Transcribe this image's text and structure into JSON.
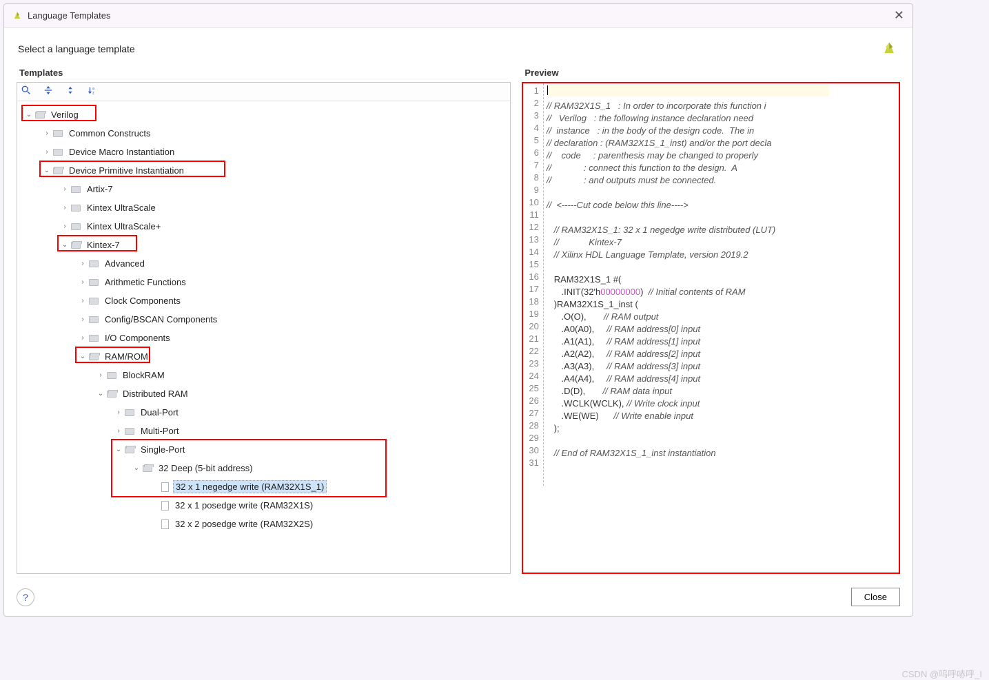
{
  "window": {
    "title": "Language Templates",
    "subtitle": "Select a language template",
    "close_label": "Close"
  },
  "panels": {
    "templates_header": "Templates",
    "preview_header": "Preview"
  },
  "toolbar_icons": [
    "search-icon",
    "collapse-icon",
    "expand-icon",
    "settings-icon"
  ],
  "tree": [
    {
      "depth": 0,
      "exp": "open",
      "icon": "folder",
      "label": "Verilog",
      "hl": true
    },
    {
      "depth": 1,
      "exp": "closed",
      "icon": "folder",
      "label": "Common Constructs"
    },
    {
      "depth": 1,
      "exp": "closed",
      "icon": "folder",
      "label": "Device Macro Instantiation"
    },
    {
      "depth": 1,
      "exp": "open",
      "icon": "folder",
      "label": "Device Primitive Instantiation",
      "hl": true
    },
    {
      "depth": 2,
      "exp": "closed",
      "icon": "folder",
      "label": "Artix-7"
    },
    {
      "depth": 2,
      "exp": "closed",
      "icon": "folder",
      "label": "Kintex UltraScale"
    },
    {
      "depth": 2,
      "exp": "closed",
      "icon": "folder",
      "label": "Kintex UltraScale+"
    },
    {
      "depth": 2,
      "exp": "open",
      "icon": "folder",
      "label": "Kintex-7",
      "hl": true
    },
    {
      "depth": 3,
      "exp": "closed",
      "icon": "folder",
      "label": "Advanced"
    },
    {
      "depth": 3,
      "exp": "closed",
      "icon": "folder",
      "label": "Arithmetic Functions"
    },
    {
      "depth": 3,
      "exp": "closed",
      "icon": "folder",
      "label": "Clock Components"
    },
    {
      "depth": 3,
      "exp": "closed",
      "icon": "folder",
      "label": "Config/BSCAN Components"
    },
    {
      "depth": 3,
      "exp": "closed",
      "icon": "folder",
      "label": "I/O Components"
    },
    {
      "depth": 3,
      "exp": "open",
      "icon": "folder",
      "label": "RAM/ROM",
      "hl": true
    },
    {
      "depth": 4,
      "exp": "closed",
      "icon": "folder",
      "label": "BlockRAM"
    },
    {
      "depth": 4,
      "exp": "open",
      "icon": "folder",
      "label": "Distributed RAM"
    },
    {
      "depth": 5,
      "exp": "closed",
      "icon": "folder",
      "label": "Dual-Port"
    },
    {
      "depth": 5,
      "exp": "closed",
      "icon": "folder",
      "label": "Multi-Port"
    },
    {
      "depth": 5,
      "exp": "open",
      "icon": "folder",
      "label": "Single-Port",
      "hlwide": true
    },
    {
      "depth": 6,
      "exp": "open",
      "icon": "folder",
      "label": "32 Deep (5-bit address)"
    },
    {
      "depth": 7,
      "exp": "none",
      "icon": "file",
      "label": "32 x 1 negedge write (RAM32X1S_1)",
      "selected": true
    },
    {
      "depth": 7,
      "exp": "none",
      "icon": "file",
      "label": "32 x 1 posedge write (RAM32X1S)"
    },
    {
      "depth": 7,
      "exp": "none",
      "icon": "file",
      "label": "32 x 2 posedge write (RAM32X2S)"
    }
  ],
  "preview_code": [
    "",
    "// RAM32X1S_1   : In order to incorporate this function i",
    "//   Verilog   : the following instance declaration need",
    "//  instance   : in the body of the design code.  The in",
    "// declaration : (RAM32X1S_1_inst) and/or the port decla",
    "//    code     : parenthesis may be changed to properly ",
    "//             : connect this function to the design.  A",
    "//             : and outputs must be connected.",
    "",
    "//  <-----Cut code below this line---->",
    "",
    "   // RAM32X1S_1: 32 x 1 negedge write distributed (LUT)",
    "   //            Kintex-7",
    "   // Xilinx HDL Language Template, version 2019.2",
    "",
    "   RAM32X1S_1 #(",
    "      .INIT(32'h00000000)  // Initial contents of RAM",
    "   )RAM32X1S_1_inst (",
    "      .O(O),       // RAM output",
    "      .A0(A0),     // RAM address[0] input",
    "      .A1(A1),     // RAM address[1] input",
    "      .A2(A2),     // RAM address[2] input",
    "      .A3(A3),     // RAM address[3] input",
    "      .A4(A4),     // RAM address[4] input",
    "      .D(D),       // RAM data input",
    "      .WCLK(WCLK), // Write clock input",
    "      .WE(WE)      // Write enable input",
    "   );",
    "",
    "   // End of RAM32X1S_1_inst instantiation",
    ""
  ],
  "watermark": "CSDN @呜呼哧呼_I"
}
